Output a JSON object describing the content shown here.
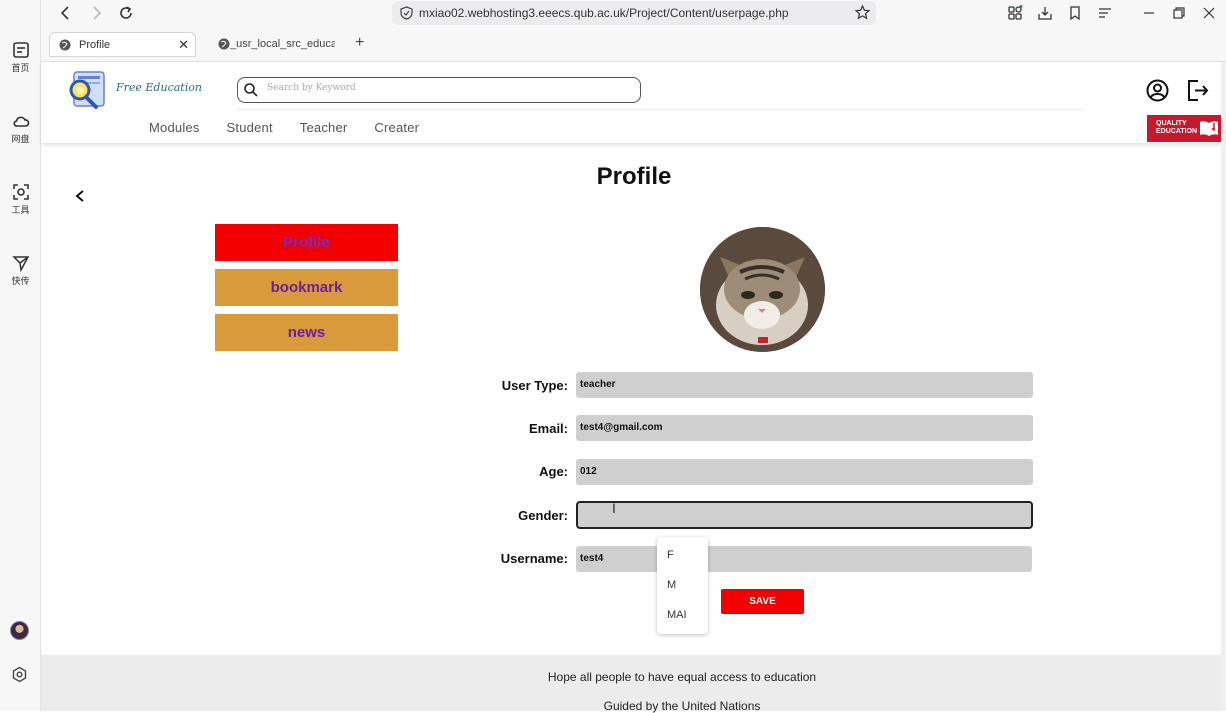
{
  "browser": {
    "url": "mxiao02.webhosting3.eeecs.qub.ac.uk/Project/Content/userpage.php",
    "tabs": [
      {
        "label": "Profile",
        "active": true
      },
      {
        "label": "_usr_local_src_education",
        "active": false
      }
    ],
    "new_tab": "+",
    "close_tab": "✕"
  },
  "siderail": {
    "items": [
      {
        "label": "首页",
        "icon": "home-feed-icon"
      },
      {
        "label": "网盘",
        "icon": "cloud-icon"
      },
      {
        "label": "工具",
        "icon": "tools-scan-icon"
      },
      {
        "label": "快传",
        "icon": "send-icon"
      }
    ]
  },
  "site": {
    "logo_text": "Free Education",
    "search_placeholder": "Search by Keyword",
    "nav": [
      "Modules",
      "Student",
      "Teacher",
      "Creater"
    ],
    "badge_text": "QUALITY EDUCATION",
    "badge_color": "#c5192d"
  },
  "page": {
    "title": "Profile",
    "menu": [
      "Profile",
      "bookmark",
      "news"
    ],
    "form": {
      "user_type_label": "User Type:",
      "user_type": "teacher",
      "email_label": "Email:",
      "email": "test4@gmail.com",
      "age_label": "Age:",
      "age": "012",
      "gender_label": "Gender:",
      "gender": "",
      "username_label": "Username:",
      "username": "test4"
    },
    "gender_options": [
      "F",
      "M",
      "MAI"
    ],
    "save_label": "SAVE"
  },
  "footer": {
    "line1": "Hope all people to have equal access to education",
    "line2": "Guided by the United Nations"
  },
  "colors": {
    "accent_red": "#f20000",
    "menu_orange": "#d99a3c",
    "menu_text": "#6b1f9a"
  }
}
